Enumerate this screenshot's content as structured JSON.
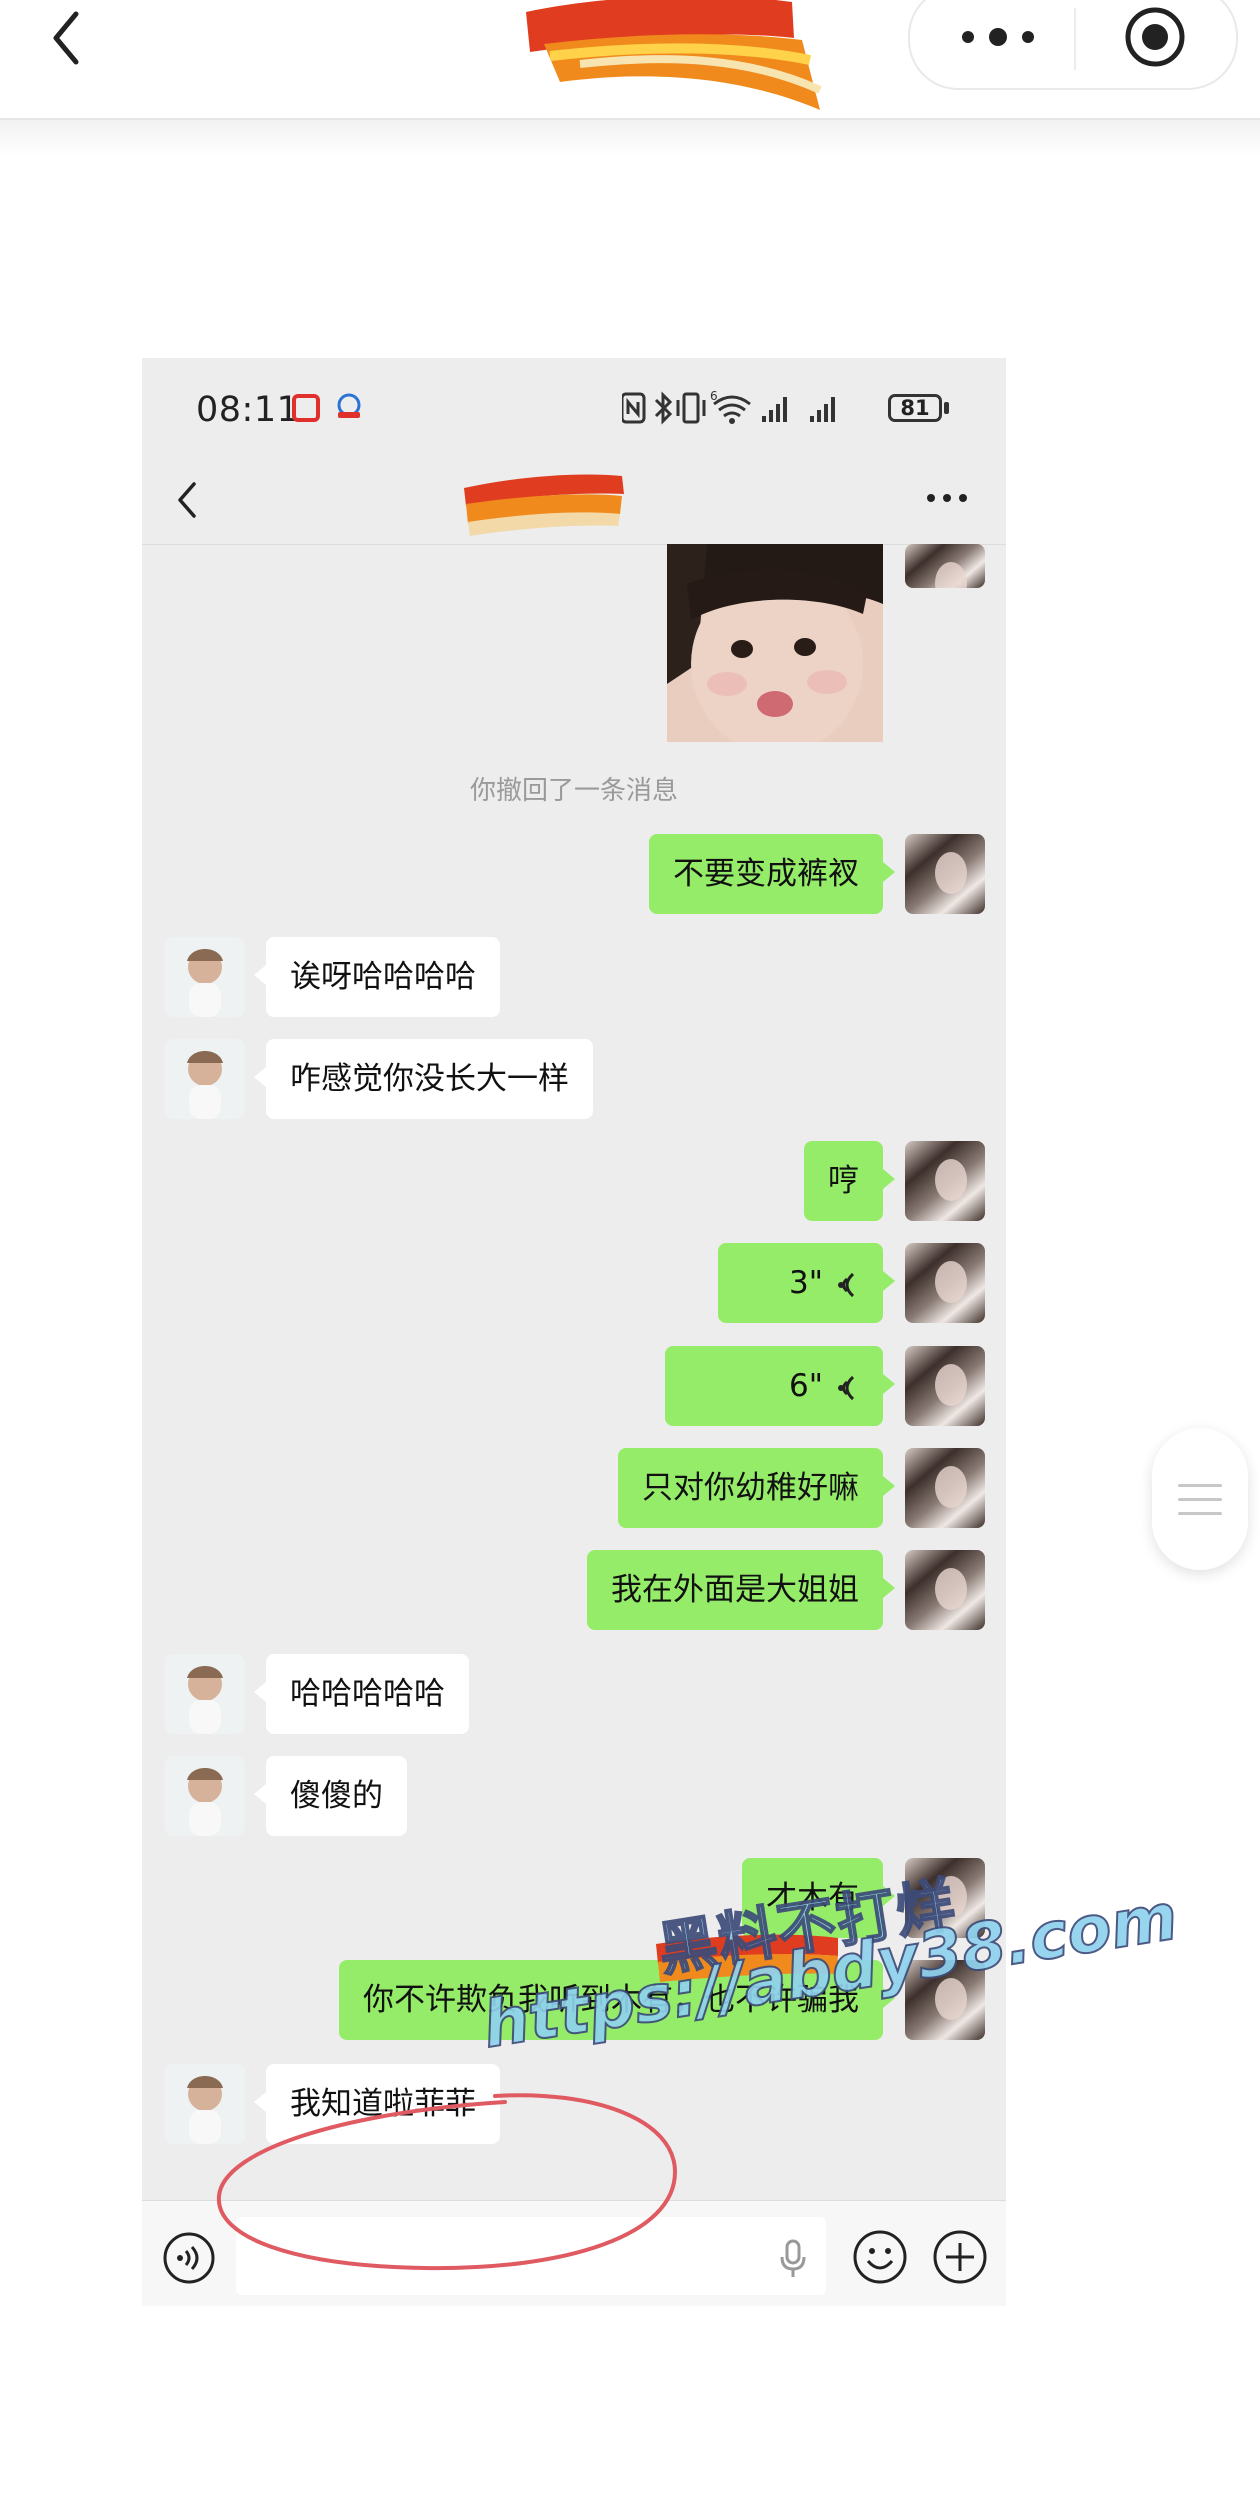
{
  "phone": {
    "status_time": "08:11",
    "battery": "81",
    "icons": {
      "network": "nfc-icon",
      "bluetooth": "bluetooth-icon",
      "vibrate": "vibrate-icon",
      "wifi": "wifi-6-icon",
      "signal": "signal-icon"
    }
  },
  "chat": {
    "recall_notice": "你撤回了一条消息",
    "messages": [
      {
        "side": "right",
        "type": "text",
        "text": "不要变成裤衩"
      },
      {
        "side": "left",
        "type": "text",
        "text": "诶呀哈哈哈哈"
      },
      {
        "side": "left",
        "type": "text",
        "text": "咋感觉你没长大一样"
      },
      {
        "side": "right",
        "type": "text",
        "text": "哼"
      },
      {
        "side": "right",
        "type": "voice",
        "text": "3\""
      },
      {
        "side": "right",
        "type": "voice",
        "text": "6\""
      },
      {
        "side": "right",
        "type": "text",
        "text": "只对你幼稚好嘛"
      },
      {
        "side": "right",
        "type": "text",
        "text": "我在外面是大姐姐"
      },
      {
        "side": "left",
        "type": "text",
        "text": "哈哈哈哈哈"
      },
      {
        "side": "left",
        "type": "text",
        "text": "傻傻的"
      },
      {
        "side": "right",
        "type": "text",
        "text": "才木有"
      },
      {
        "side": "right",
        "type": "text",
        "text": "你不许欺负我听到木有，也不许骗我"
      },
      {
        "side": "left",
        "type": "text",
        "text": "我知道啦菲菲"
      }
    ]
  },
  "watermark": {
    "title": "黑料不打烊",
    "url": "https://abdy38.com"
  },
  "colors": {
    "self_bubble": "#95ec69",
    "friend_bubble": "#ffffff",
    "chat_bg": "#ededed",
    "annotation": "#e05a62"
  }
}
